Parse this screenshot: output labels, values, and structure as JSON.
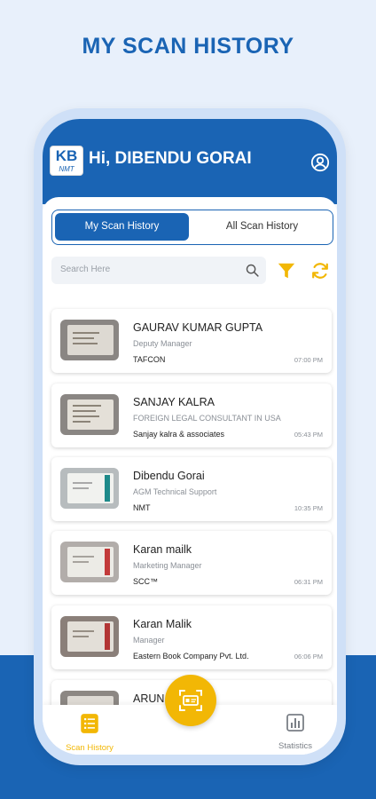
{
  "promo_title": "MY SCAN HISTORY",
  "header": {
    "logo_text": "KB",
    "logo_subtext": "NMT",
    "greeting": "Hi, DIBENDU GORAI"
  },
  "tabs": {
    "my_scan_history": "My Scan History",
    "all_scan_history": "All Scan History"
  },
  "search": {
    "placeholder": "Search Here"
  },
  "cards": [
    {
      "name": "GAURAV KUMAR GUPTA",
      "role": "Deputy Manager",
      "company": "TAFCON",
      "time": "07:00 PM"
    },
    {
      "name": "SANJAY KALRA",
      "role": "FOREIGN LEGAL CONSULTANT IN USA",
      "company": "Sanjay kalra & associates",
      "time": "05:43 PM"
    },
    {
      "name": "Dibendu Gorai",
      "role": "AGM Technical Support",
      "company": "NMT",
      "time": "10:35 PM"
    },
    {
      "name": "Karan mailk",
      "role": "Marketing Manager",
      "company": "SCC™",
      "time": "06:31 PM"
    },
    {
      "name": "Karan Malik",
      "role": "Manager",
      "company": "Eastern Book Company Pvt. Ltd.",
      "time": "06:06 PM"
    },
    {
      "name": "ARUN",
      "role": "",
      "company": "",
      "time": ""
    }
  ],
  "bottom_nav": {
    "scan_history": "Scan History",
    "statistics": "Statistics"
  },
  "colors": {
    "primary": "#1a64b4",
    "accent": "#f2b705",
    "background": "#e8f0fb"
  },
  "icons": [
    "profile-icon",
    "search-icon",
    "filter-icon",
    "refresh-icon",
    "scan-history-icon",
    "statistics-icon",
    "scan-card-icon"
  ]
}
